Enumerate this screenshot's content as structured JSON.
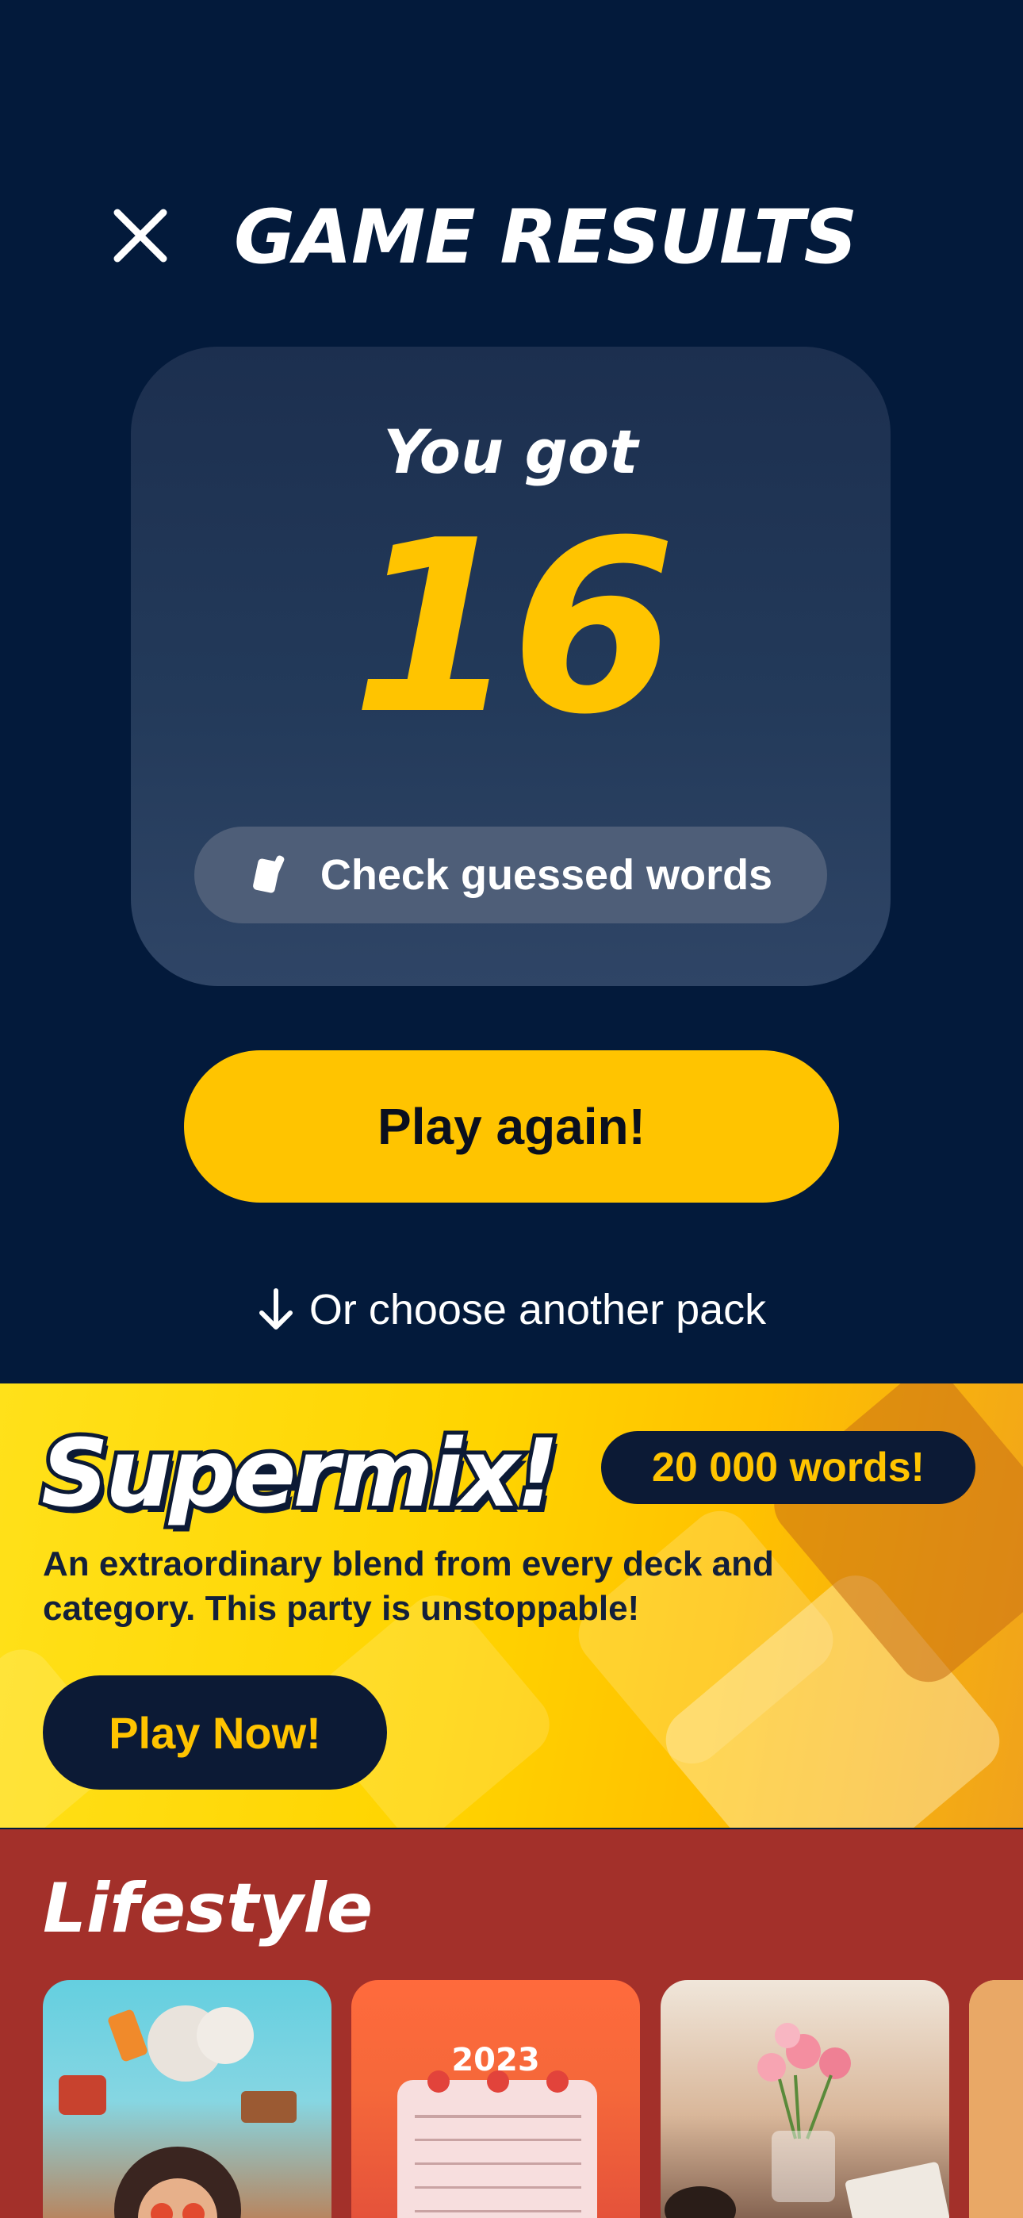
{
  "header": {
    "title": "GAME RESULTS"
  },
  "score_card": {
    "label": "You got",
    "score": "16",
    "check_button_label": "Check guessed words"
  },
  "actions": {
    "play_again_label": "Play again!",
    "choose_pack_label": "Or choose another pack"
  },
  "supermix": {
    "title": "Supermix!",
    "badge": "20 000 words!",
    "description": "An extraordinary blend from every deck and category. This party is unstoppable!",
    "play_label": "Play Now!"
  },
  "lifestyle": {
    "title": "Lifestyle",
    "tiles": [
      {
        "icon": "character-collage-image"
      },
      {
        "icon": "calendar-image",
        "text": "2023"
      },
      {
        "icon": "flowers-table-image"
      },
      {
        "icon": "pack-image"
      }
    ]
  },
  "colors": {
    "background": "#031a3b",
    "accent": "#ffc400",
    "card": "#233a5a",
    "lifestyle_bg": "#a3302a"
  }
}
